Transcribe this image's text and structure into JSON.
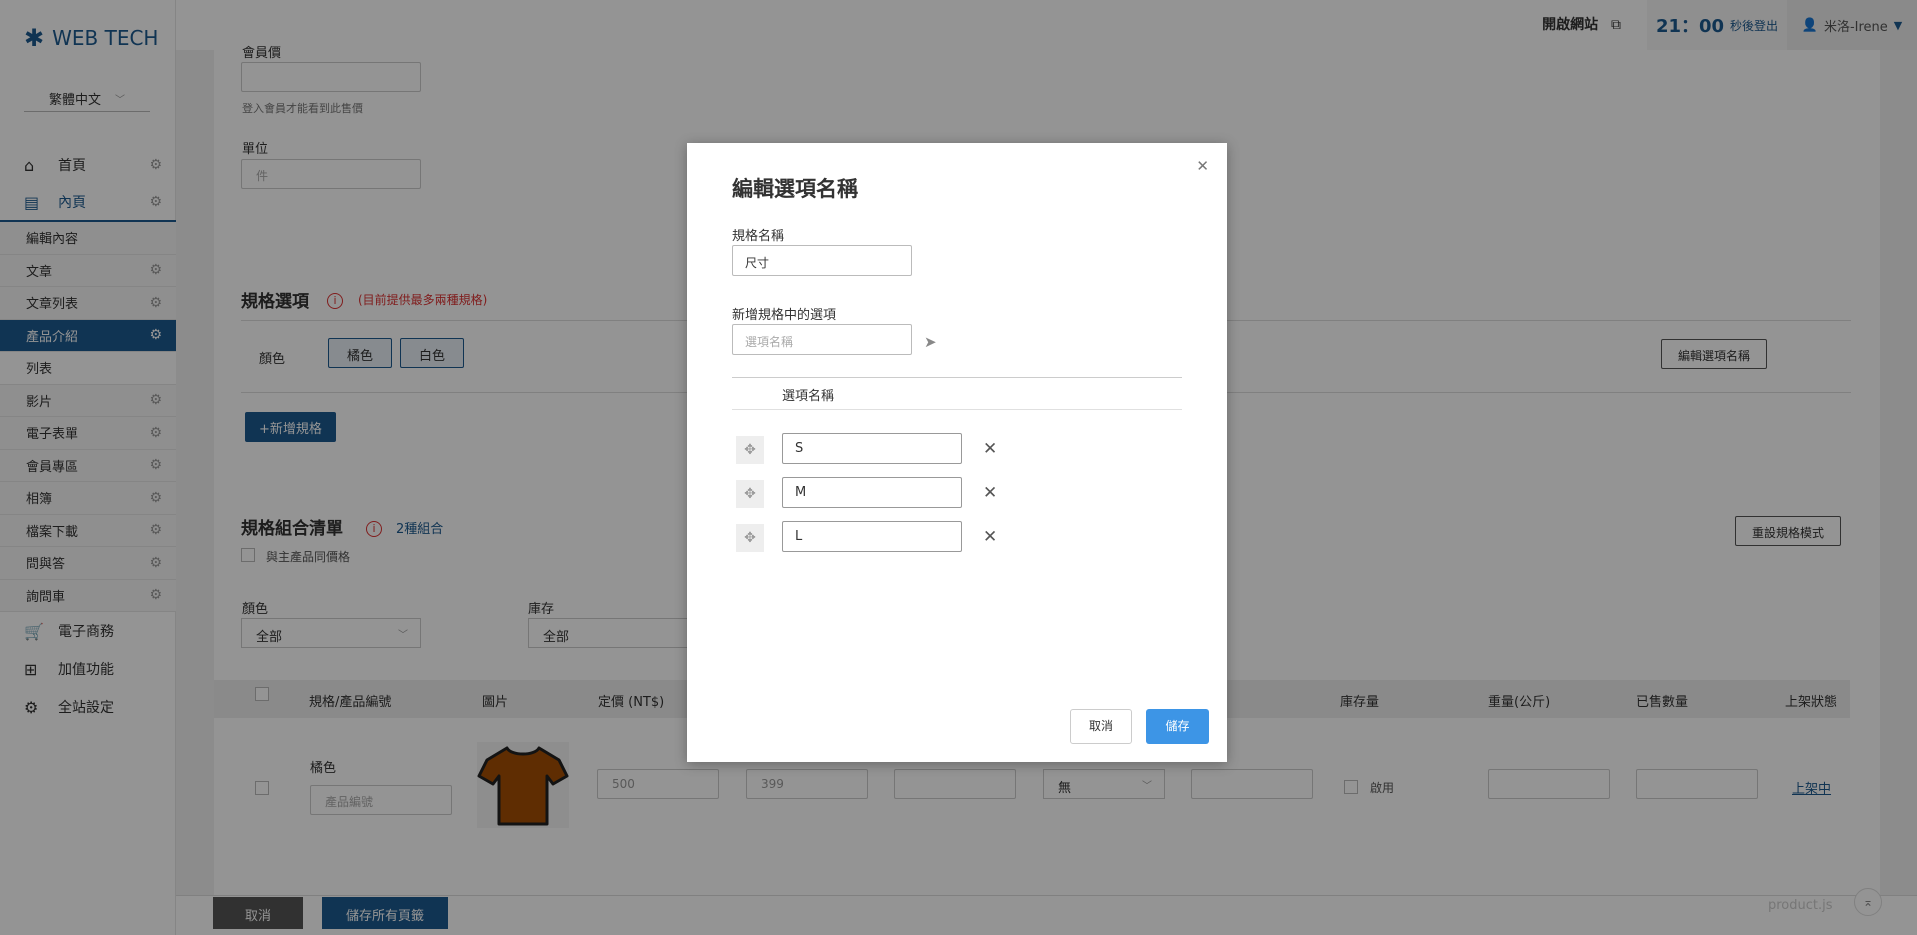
{
  "brand": {
    "logo_text": "WEB TECH"
  },
  "language": {
    "selected": "繁體中文"
  },
  "sidebar": {
    "top_items": [
      {
        "label": "首頁"
      },
      {
        "label": "內頁"
      }
    ],
    "sub_items": [
      {
        "label": "編輯內容"
      },
      {
        "label": "文章"
      },
      {
        "label": "文章列表"
      },
      {
        "label": "產品介紹"
      },
      {
        "label": "列表"
      },
      {
        "label": "影片"
      },
      {
        "label": "電子表單"
      },
      {
        "label": "會員專區"
      },
      {
        "label": "相簿"
      },
      {
        "label": "檔案下載"
      },
      {
        "label": "問與答"
      },
      {
        "label": "詢問車"
      }
    ],
    "bottom_items": [
      {
        "label": "電子商務"
      },
      {
        "label": "加值功能"
      },
      {
        "label": "全站設定"
      }
    ]
  },
  "topbar": {
    "open_site": "開啟網站",
    "timer": "21：00",
    "timer_label": "秒後登出",
    "user": "米洛-Irene"
  },
  "form": {
    "member_price_label": "會員價",
    "member_price_help": "登入會員才能看到此售價",
    "unit_label": "單位",
    "unit_placeholder": "件"
  },
  "spec_section": {
    "title": "規格選項",
    "warning": "(目前提供最多兩種規格)",
    "color_label": "顏色",
    "chips": [
      "橘色",
      "白色"
    ],
    "edit_button": "編輯選項名稱",
    "add_button": "+新增規格"
  },
  "combo_section": {
    "title": "規格組合清單",
    "count": "2種組合",
    "same_price": "與主產品同價格",
    "reset_button": "重設規格模式",
    "filter_color_label": "顏色",
    "filter_color_value": "全部",
    "filter_stock_label": "庫存",
    "filter_stock_value": "全部"
  },
  "table": {
    "headers": [
      "規格/產品編號",
      "圖片",
      "定價 (NT$)",
      "庫存量",
      "重量(公斤)",
      "已售數量",
      "上架狀態"
    ],
    "row": {
      "spec": "橘色",
      "sku_placeholder": "產品編號",
      "price": "500",
      "sale_price": "399",
      "select_value": "無",
      "enable_label": "啟用",
      "status": "上架中"
    }
  },
  "bottom": {
    "cancel": "取消",
    "save_all": "儲存所有頁籤",
    "file": "product.js"
  },
  "modal": {
    "title": "編輯選項名稱",
    "spec_name_label": "規格名稱",
    "spec_name_value": "尺寸",
    "new_option_label": "新增規格中的選項",
    "new_option_placeholder": "選項名稱",
    "column_header": "選項名稱",
    "options": [
      "S",
      "M",
      "L"
    ],
    "cancel": "取消",
    "save": "儲存"
  },
  "colors": {
    "brand": "#1d5a8f",
    "primary_button": "#3d95e6",
    "warning": "#dd3333",
    "tshirt": "#a44f04"
  }
}
